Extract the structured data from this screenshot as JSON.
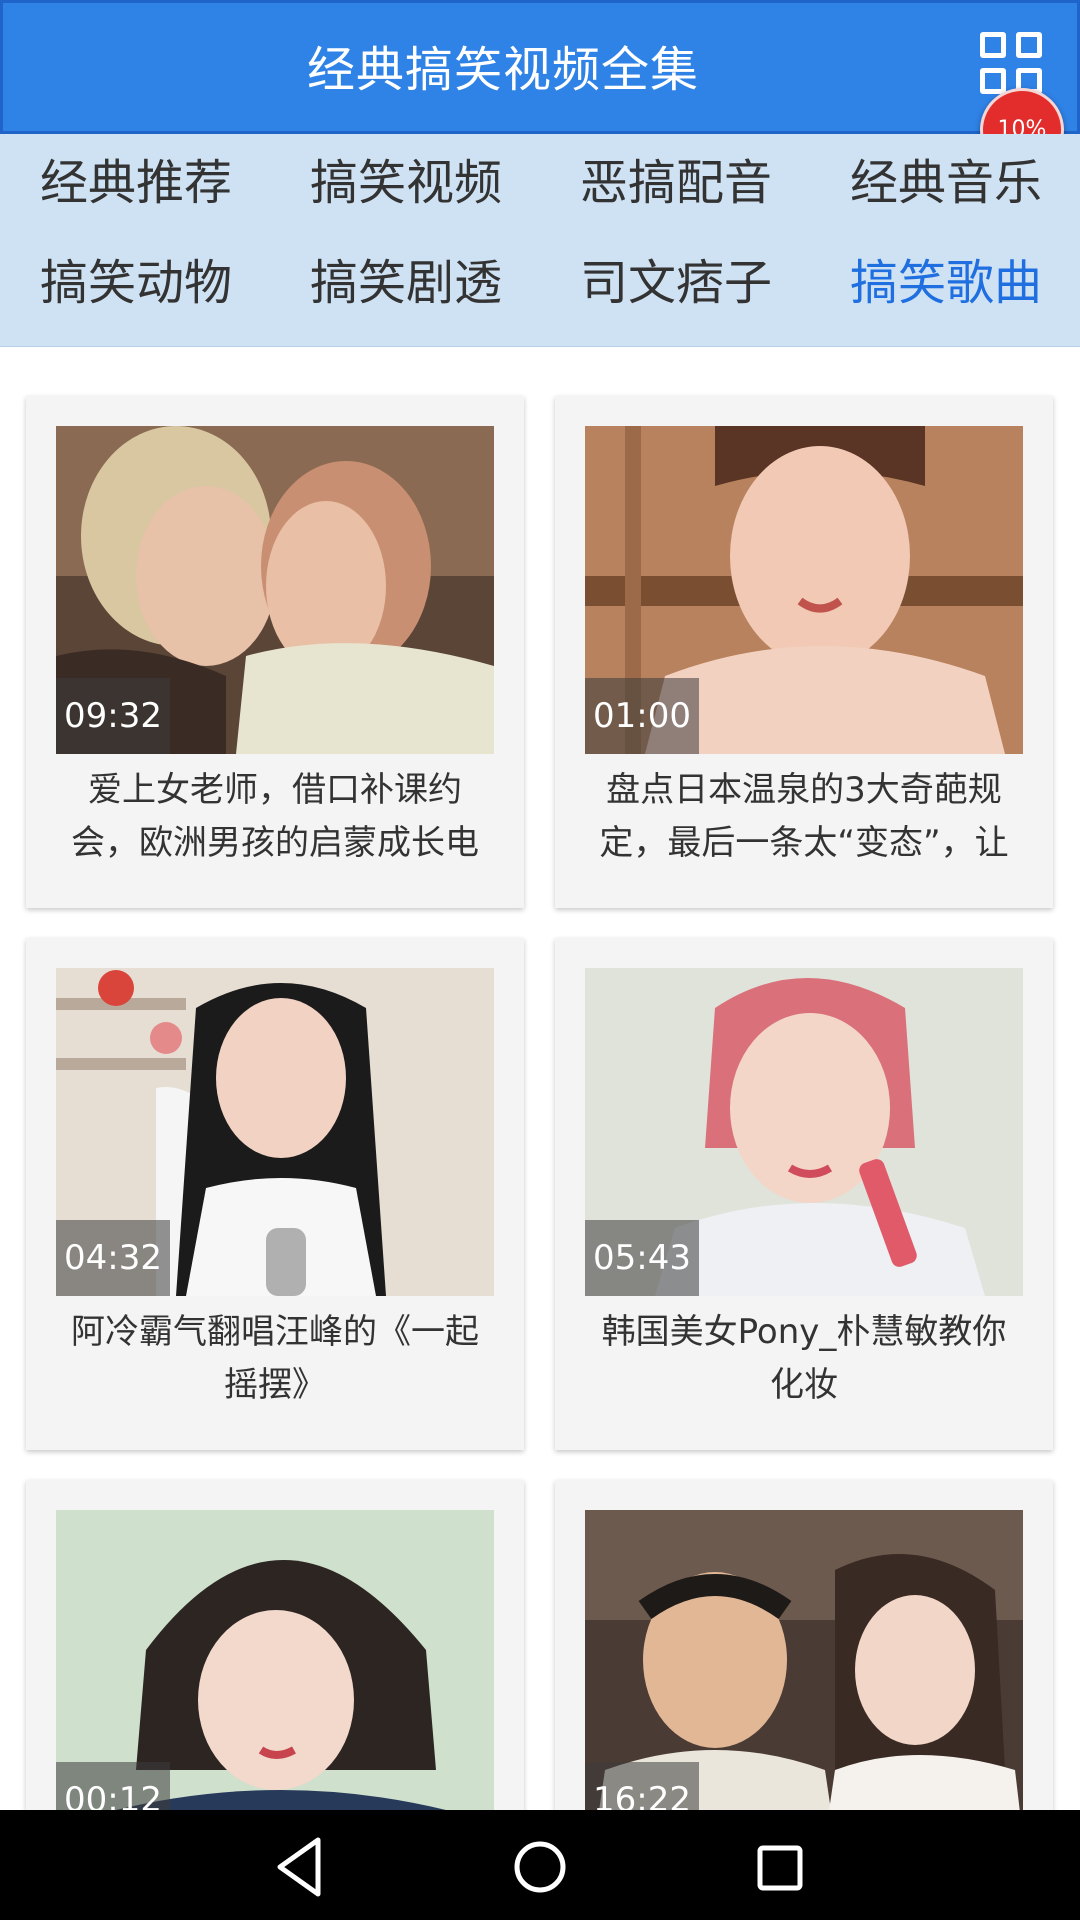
{
  "header": {
    "title": "经典搞笑视频全集",
    "badge": "10%",
    "menu_icon": "grid-icon"
  },
  "categories": [
    {
      "label": "经典推荐",
      "active": false
    },
    {
      "label": "搞笑视频",
      "active": false
    },
    {
      "label": "恶搞配音",
      "active": false
    },
    {
      "label": "经典音乐",
      "active": false
    },
    {
      "label": "搞笑动物",
      "active": false
    },
    {
      "label": "搞笑剧透",
      "active": false
    },
    {
      "label": "司文痞子",
      "active": false
    },
    {
      "label": "搞笑歌曲",
      "active": true
    }
  ],
  "videos": [
    {
      "duration": "09:32",
      "title": "爱上女老师，借口补课约会，欧洲男孩的启蒙成长电"
    },
    {
      "duration": "01:00",
      "title": "盘点日本温泉的3大奇葩规定，最后一条太“变态”，让"
    },
    {
      "duration": "04:32",
      "title": "阿冷霸气翻唱汪峰的《一起摇摆》"
    },
    {
      "duration": "05:43",
      "title": "韩国美女Pony_朴慧敏教你化妆"
    },
    {
      "duration": "00:12",
      "title": ""
    },
    {
      "duration": "16:22",
      "title": ""
    }
  ],
  "nav": {
    "back_icon": "back-triangle-icon",
    "home_icon": "home-circle-icon",
    "recents_icon": "recents-square-icon"
  },
  "colors": {
    "header_bg": "#2f82e6",
    "category_bg": "#cfe2f3",
    "active_category": "#1f6fe0",
    "badge": "#e32d2d"
  }
}
